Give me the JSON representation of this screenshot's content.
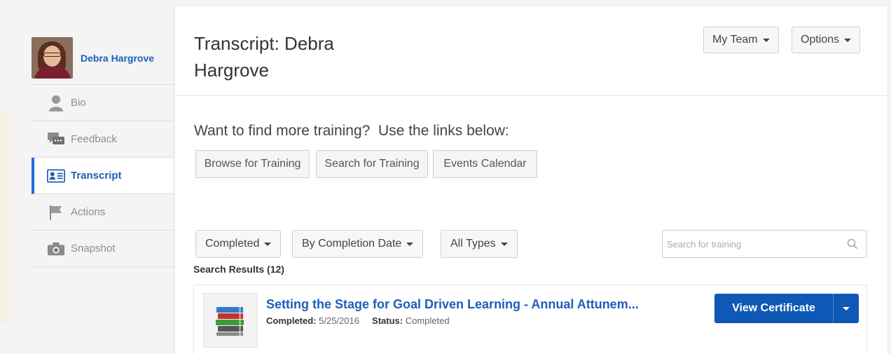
{
  "sidebar": {
    "user_name": "Debra Hargrove",
    "items": [
      {
        "label": "Bio",
        "icon": "person-icon"
      },
      {
        "label": "Feedback",
        "icon": "chat-icon"
      },
      {
        "label": "Transcript",
        "icon": "transcript-icon"
      },
      {
        "label": "Actions",
        "icon": "flag-icon"
      },
      {
        "label": "Snapshot",
        "icon": "camera-icon"
      }
    ],
    "active_item": "Transcript"
  },
  "header": {
    "title": "Transcript: Debra Hargrove",
    "my_team_label": "My Team",
    "options_label": "Options"
  },
  "find": {
    "text": "Want to find more training?  Use the links below:",
    "browse_label": "Browse for Training",
    "search_label": "Search for Training",
    "events_label": "Events Calendar"
  },
  "filters": {
    "status": "Completed",
    "sort": "By Completion Date",
    "type": "All Types",
    "search_placeholder": "Search for training"
  },
  "results": {
    "label": "Search Results (12)",
    "items": [
      {
        "title": "Setting the Stage for Goal Driven Learning - Annual Attunem...",
        "completed_label": "Completed:",
        "completed_date": "5/25/2016",
        "status_label": "Status:",
        "status": "Completed",
        "action_label": "View Certificate"
      }
    ]
  },
  "colors": {
    "accent": "#1f5fb8",
    "primary_button": "#0e58b6"
  }
}
